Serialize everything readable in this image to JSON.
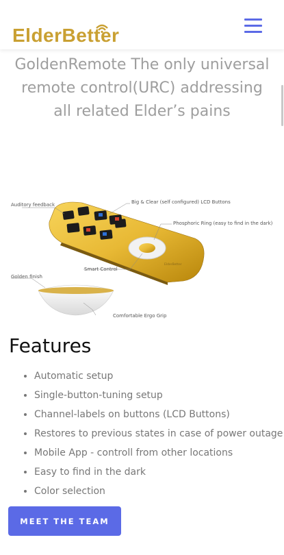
{
  "header": {
    "brand": "ElderBetter",
    "menu_icon": "hamburger-menu-icon"
  },
  "hero": {
    "headline": "GoldenRemote The only universal remote control(URC) addressing all related Elder’s pains"
  },
  "product_image": {
    "callouts": {
      "auditory_feedback": "Auditory feedback",
      "lcd_buttons": "Big & Clear (self configured) LCD Buttons",
      "phosphoric_ring": "Phosphoric Ring (easy to find in the dark)",
      "smart_control": "Smart Control",
      "golden_finish": "Golden finish",
      "ergo_grip": "Comfortable Ergo Grip"
    },
    "brand_mark": "ElderBetter"
  },
  "features": {
    "title": "Features",
    "items": [
      "Automatic setup",
      "Single-button-tuning setup",
      "Channel-labels on buttons (LCD Buttons)",
      "Restores to previous states in case of power outage",
      "Mobile App - controll from other locations",
      "Easy to find in the dark",
      "Color selection"
    ]
  },
  "cta": {
    "team_button": "MEET THE TEAM"
  },
  "colors": {
    "brand_gold": "#c9a032",
    "accent": "#5b6ae6",
    "headline_gray": "#9e9e9e"
  }
}
